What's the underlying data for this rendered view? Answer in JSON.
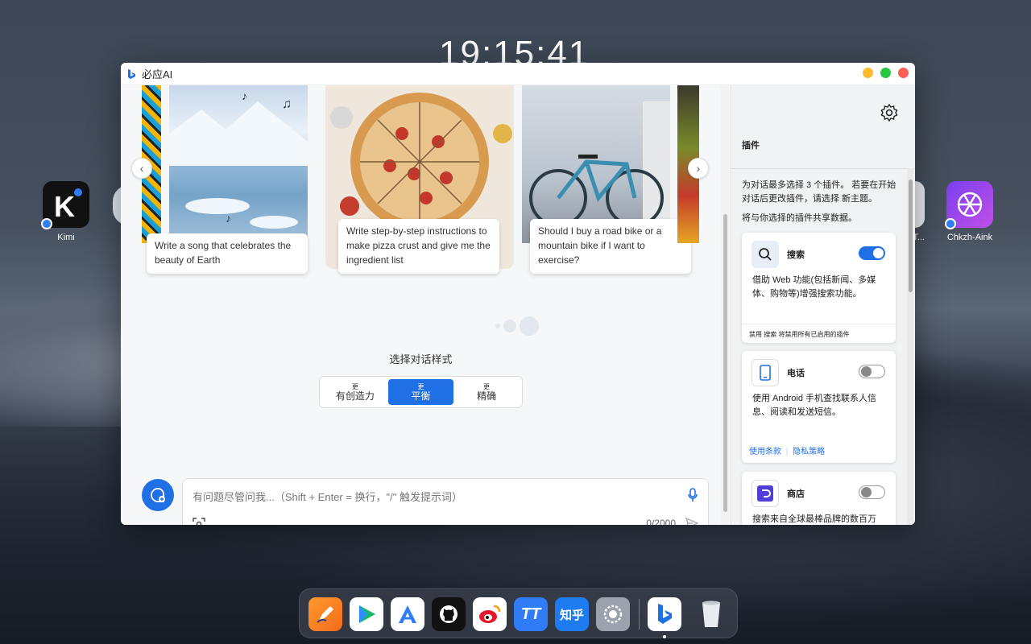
{
  "desktop": {
    "clock": "19:15:41",
    "icons": [
      {
        "label": "Kimi"
      },
      {
        "label": "Chkzh-Aink"
      },
      {
        "label": "PT..."
      }
    ]
  },
  "window": {
    "title": "必应AI",
    "colors": {
      "close": "#ff5f57",
      "minimize": "#febc2e",
      "maximize": "#28c840",
      "accent": "#1f6fe5"
    }
  },
  "carousel": {
    "cards": [
      {
        "caption": "Write a song that celebrates the beauty of Earth"
      },
      {
        "caption": "Write step-by-step instructions to make pizza crust and give me the ingredient list"
      },
      {
        "caption": "Should I buy a road bike or a mountain bike if I want to exercise?"
      }
    ],
    "prev_icon": "chevron-left-icon",
    "next_icon": "chevron-right-icon"
  },
  "style_selector": {
    "title": "选择对话样式",
    "options": [
      {
        "prefix": "更",
        "label": "有创造力"
      },
      {
        "prefix": "更",
        "label": "平衡"
      },
      {
        "prefix": "更",
        "label": "精确"
      }
    ],
    "active": "平衡"
  },
  "input": {
    "placeholder": "有问题尽管问我...（Shift + Enter = 换行，\"/\" 触发提示词）",
    "counter": "0/2000"
  },
  "sidebar": {
    "title": "插件",
    "description": "为对话最多选择 3 个插件。 若要在开始对话后更改插件，请选择 新主题。",
    "share_note": "将与你选择的插件共享数据。",
    "plugins": [
      {
        "name": "搜索",
        "enabled": true,
        "description": "借助 Web 功能(包括新闻、多媒体、购物等)增强搜索功能。",
        "footer": "禁用 搜索 将禁用所有已启用的插件"
      },
      {
        "name": "电话",
        "enabled": false,
        "description": "使用 Android 手机查找联系人信息、阅读和发送短信。",
        "links": [
          "使用条款",
          "隐私策略"
        ]
      },
      {
        "name": "商店",
        "enabled": false,
        "description": "搜索来自全球最棒品牌的数百万"
      }
    ]
  },
  "dock": {
    "apps": [
      "pen-app",
      "video-player",
      "app-store",
      "github",
      "weibo",
      "tt",
      "知乎",
      "settings",
      "bing",
      "trash"
    ],
    "zhihu_label": "知乎",
    "tt_label": "TT"
  }
}
